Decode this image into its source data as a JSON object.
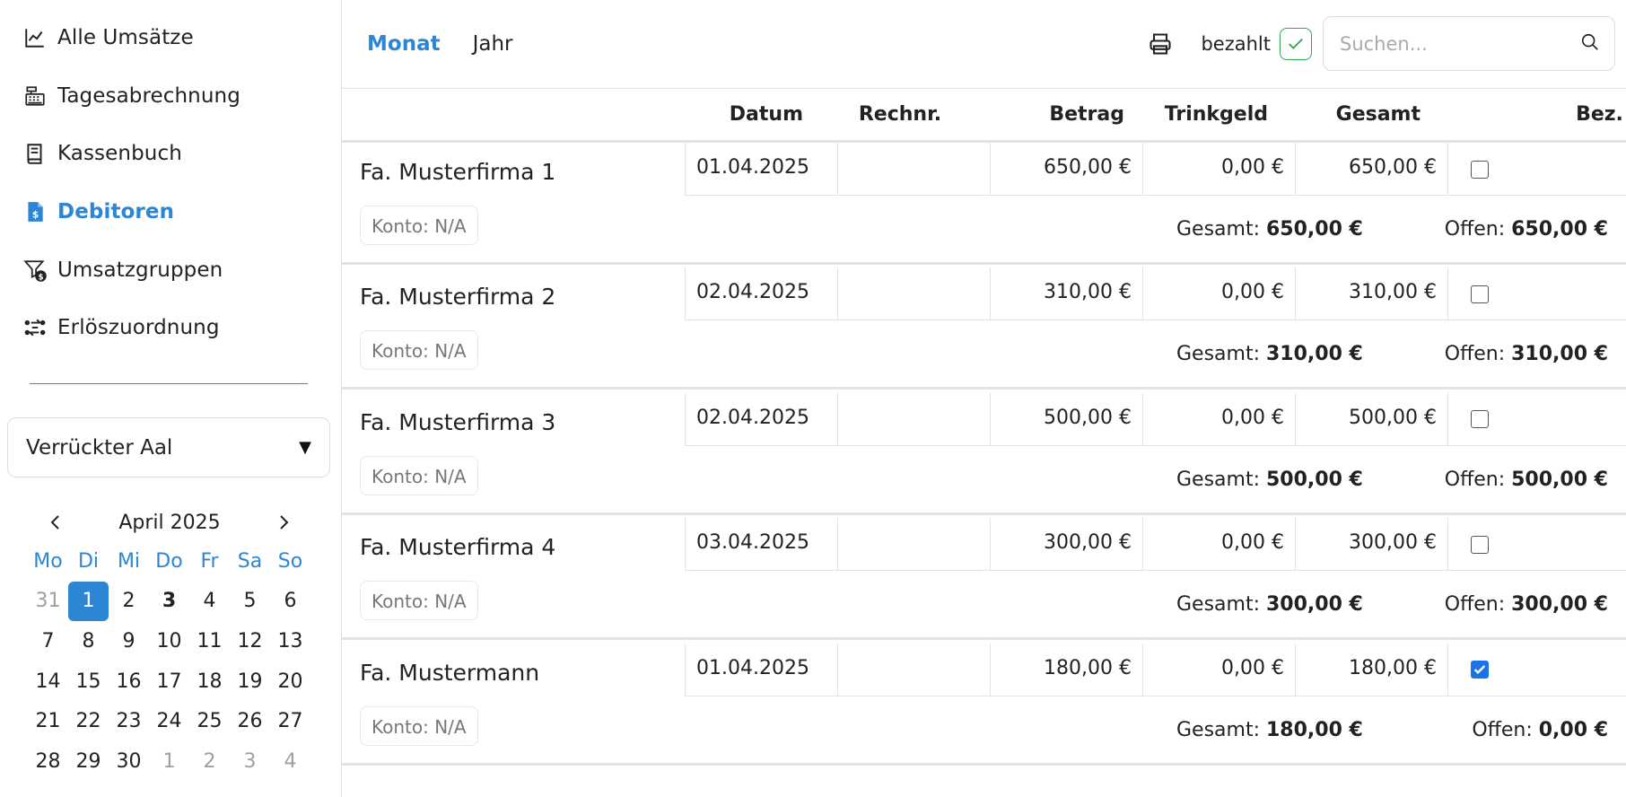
{
  "sidebar": {
    "nav": [
      {
        "label": "Alle Umsätze",
        "icon": "chart-line-icon"
      },
      {
        "label": "Tagesabrechnung",
        "icon": "cash-register-icon"
      },
      {
        "label": "Kassenbuch",
        "icon": "book-icon"
      },
      {
        "label": "Debitoren",
        "icon": "invoice-dollar-icon",
        "active": true
      },
      {
        "label": "Umsatzgruppen",
        "icon": "filter-dollar-icon"
      },
      {
        "label": "Erlöszuordnung",
        "icon": "transfer-icon"
      }
    ],
    "selected_store": "Verrückter Aal",
    "calendar": {
      "month_label": "April 2025",
      "weekdays": [
        "Mo",
        "Di",
        "Mi",
        "Do",
        "Fr",
        "Sa",
        "So"
      ],
      "days": [
        "31",
        "1",
        "2",
        "3",
        "4",
        "5",
        "6",
        "7",
        "8",
        "9",
        "10",
        "11",
        "12",
        "13",
        "14",
        "15",
        "16",
        "17",
        "18",
        "19",
        "20",
        "21",
        "22",
        "23",
        "24",
        "25",
        "26",
        "27",
        "28",
        "29",
        "30",
        "1",
        "2",
        "3",
        "4"
      ]
    }
  },
  "header": {
    "tabs": [
      {
        "label": "Monat",
        "active": true
      },
      {
        "label": "Jahr"
      }
    ],
    "paid_label": "bezahlt",
    "search_placeholder": "Suchen..."
  },
  "table": {
    "columns": {
      "datum": "Datum",
      "rechnr": "Rechnr.",
      "betrag": "Betrag",
      "trinkgeld": "Trinkgeld",
      "gesamt": "Gesamt",
      "bez": "Bez."
    },
    "summary_labels": {
      "total": "Gesamt:",
      "open": "Offen:"
    },
    "groups": [
      {
        "name": "Fa. Musterfirma 1",
        "konto": "Konto: N/A",
        "date": "01.04.2025",
        "rechnr": "",
        "betrag": "650,00 €",
        "trinkgeld": "0,00 €",
        "gesamt": "650,00 €",
        "paid": false,
        "sum_total": "650,00 €",
        "sum_open": "650,00 €"
      },
      {
        "name": "Fa. Musterfirma 2",
        "konto": "Konto: N/A",
        "date": "02.04.2025",
        "rechnr": "",
        "betrag": "310,00 €",
        "trinkgeld": "0,00 €",
        "gesamt": "310,00 €",
        "paid": false,
        "sum_total": "310,00 €",
        "sum_open": "310,00 €"
      },
      {
        "name": "Fa. Musterfirma 3",
        "konto": "Konto: N/A",
        "date": "02.04.2025",
        "rechnr": "",
        "betrag": "500,00 €",
        "trinkgeld": "0,00 €",
        "gesamt": "500,00 €",
        "paid": false,
        "sum_total": "500,00 €",
        "sum_open": "500,00 €"
      },
      {
        "name": "Fa. Musterfirma 4",
        "konto": "Konto: N/A",
        "date": "03.04.2025",
        "rechnr": "",
        "betrag": "300,00 €",
        "trinkgeld": "0,00 €",
        "gesamt": "300,00 €",
        "paid": false,
        "sum_total": "300,00 €",
        "sum_open": "300,00 €"
      },
      {
        "name": "Fa. Mustermann",
        "konto": "Konto: N/A",
        "date": "01.04.2025",
        "rechnr": "",
        "betrag": "180,00 €",
        "trinkgeld": "0,00 €",
        "gesamt": "180,00 €",
        "paid": true,
        "sum_total": "180,00 €",
        "sum_open": "0,00 €"
      }
    ]
  },
  "colors": {
    "accent": "#2d86d4",
    "paid_green": "#2ca84d",
    "checkbox_blue": "#1a73e8"
  }
}
